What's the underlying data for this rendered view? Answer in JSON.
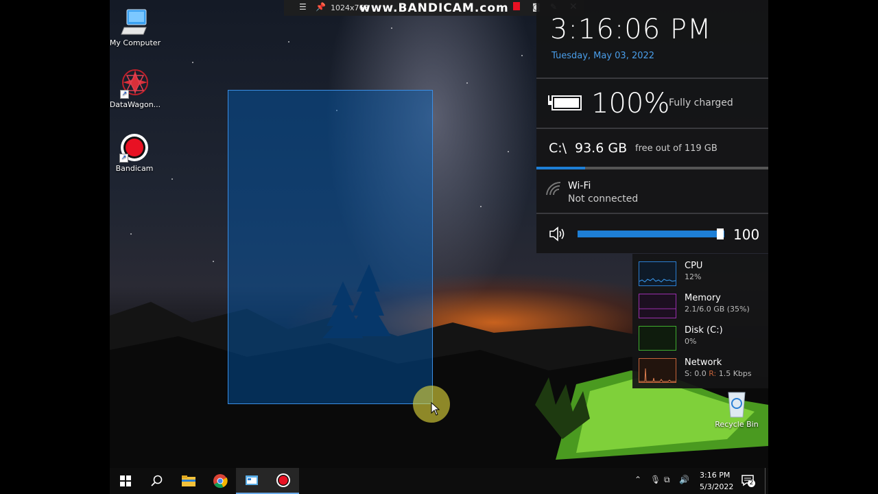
{
  "desktop": {
    "icons": [
      {
        "label": "My Computer"
      },
      {
        "label": "DataWagon..."
      },
      {
        "label": "Bandicam"
      },
      {
        "label": "Recycle Bin"
      }
    ]
  },
  "bandicam_bar": {
    "resolution": "1024x768",
    "logo": "www.BANDICAM.com"
  },
  "clock_widget": {
    "time": "3:16:06 PM",
    "date": "Tuesday, May 03, 2022"
  },
  "battery": {
    "percent": "100%",
    "status": "Fully charged"
  },
  "drive": {
    "name": "C:\\",
    "free": "93.6 GB",
    "total": "free out of 119 GB",
    "used_fraction": 0.21
  },
  "wifi": {
    "name": "Wi-Fi",
    "status": "Not connected"
  },
  "volume": {
    "value": "100",
    "level_percent": 100
  },
  "monitor": {
    "cpu": {
      "label": "CPU",
      "value": "12%",
      "color": "#2a7fd4"
    },
    "memory": {
      "label": "Memory",
      "value": "2.1/6.0 GB (35%)",
      "color": "#9b2fae"
    },
    "disk": {
      "label": "Disk (C:)",
      "value": "0%",
      "color": "#3fae2f"
    },
    "network": {
      "label": "Network",
      "sent_label": "S:",
      "sent": "0.0",
      "recv_label": "R:",
      "recv": "1.5 Kbps",
      "color": "#c8643a"
    }
  },
  "taskbar": {
    "clock_time": "3:16 PM",
    "clock_date": "5/3/2022",
    "notification_count": "2"
  },
  "colors": {
    "accent": "#1e7fd6",
    "date_blue": "#4a9eea",
    "record_red": "#e81123"
  }
}
